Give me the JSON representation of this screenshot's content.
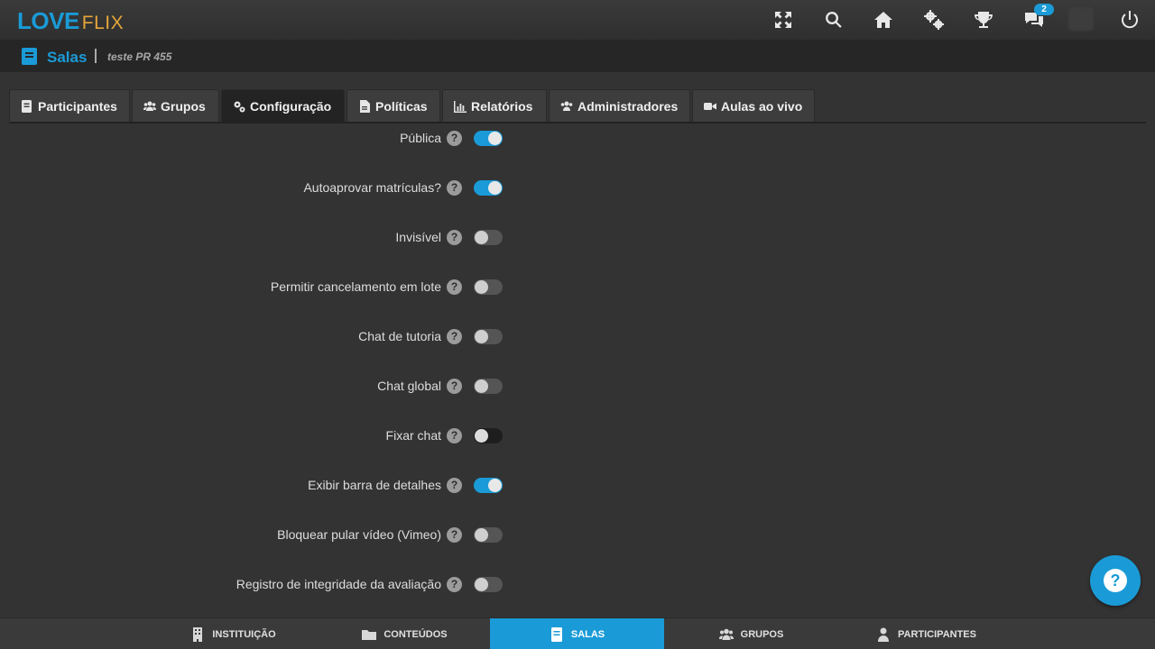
{
  "app": {
    "logo_left": "LOVE",
    "logo_right": "FLIX",
    "notification_count": "2"
  },
  "header": {
    "section_title": "Salas",
    "course_name": "teste PR 455"
  },
  "tabs": [
    {
      "label": "Participantes",
      "icon": "book-icon"
    },
    {
      "label": "Grupos",
      "icon": "users-icon"
    },
    {
      "label": "Configuração",
      "icon": "gears-icon"
    },
    {
      "label": "Políticas",
      "icon": "file-icon"
    },
    {
      "label": "Relatórios",
      "icon": "chart-icon"
    },
    {
      "label": "Administradores",
      "icon": "users-icon"
    },
    {
      "label": "Aulas ao vivo",
      "icon": "video-icon"
    }
  ],
  "active_tab": "Configuração",
  "settings": [
    {
      "label": "Pública",
      "enabled": true
    },
    {
      "label": "Autoaprovar matrículas?",
      "enabled": true
    },
    {
      "label": "Invisível",
      "enabled": false
    },
    {
      "label": "Permitir cancelamento em lote",
      "enabled": false
    },
    {
      "label": "Chat de tutoria",
      "enabled": false
    },
    {
      "label": "Chat global",
      "enabled": false
    },
    {
      "label": "Fixar chat",
      "enabled": false
    },
    {
      "label": "Exibir barra de detalhes",
      "enabled": true
    },
    {
      "label": "Bloquear pular vídeo (Vimeo)",
      "enabled": false
    },
    {
      "label": "Registro de integridade da avaliação",
      "enabled": false
    }
  ],
  "help_glyph": "?",
  "bottom_nav": [
    {
      "label": "INSTITUIÇÃO",
      "icon": "building-icon"
    },
    {
      "label": "CONTEÚDOS",
      "icon": "folder-icon"
    },
    {
      "label": "SALAS",
      "icon": "book-icon"
    },
    {
      "label": "GRUPOS",
      "icon": "users-icon"
    },
    {
      "label": "PARTICIPANTES",
      "icon": "user-icon"
    }
  ],
  "active_bottom": "SALAS",
  "colors": {
    "accent": "#1a9bd7",
    "logo_secondary": "#e5a63a",
    "background": "#333333"
  }
}
